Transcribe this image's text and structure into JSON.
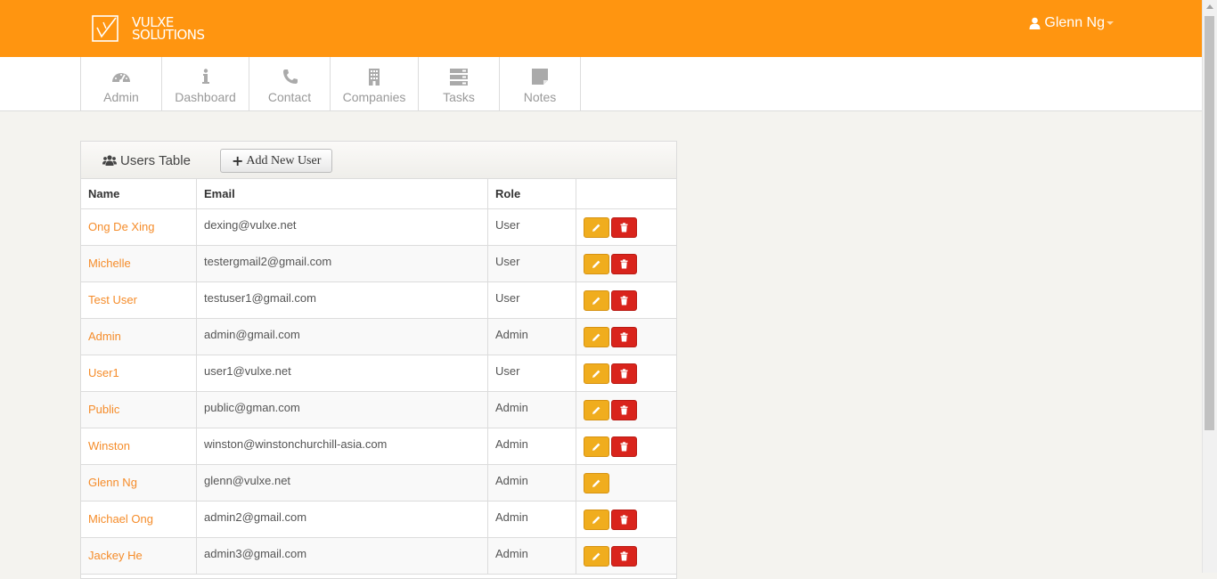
{
  "brand": {
    "line1": "VULXE",
    "line2": "SOLUTIONS"
  },
  "user": {
    "name": "Glenn Ng"
  },
  "nav": [
    {
      "label": "Admin",
      "icon": "dashboard-gauge-icon"
    },
    {
      "label": "Dashboard",
      "icon": "info-icon"
    },
    {
      "label": "Contact",
      "icon": "phone-icon"
    },
    {
      "label": "Companies",
      "icon": "building-icon"
    },
    {
      "label": "Tasks",
      "icon": "tasks-icon"
    },
    {
      "label": "Notes",
      "icon": "note-icon"
    }
  ],
  "panel": {
    "title": "Users Table",
    "add_button": "Add New User"
  },
  "table": {
    "columns": [
      "Name",
      "Email",
      "Role",
      ""
    ],
    "rows": [
      {
        "name": "Ong De Xing",
        "email": "dexing@vulxe.net",
        "role": "User",
        "deletable": true
      },
      {
        "name": "Michelle",
        "email": "testergmail2@gmail.com",
        "role": "User",
        "deletable": true
      },
      {
        "name": "Test User",
        "email": "testuser1@gmail.com",
        "role": "User",
        "deletable": true
      },
      {
        "name": "Admin",
        "email": "admin@gmail.com",
        "role": "Admin",
        "deletable": true
      },
      {
        "name": "User1",
        "email": "user1@vulxe.net",
        "role": "User",
        "deletable": true
      },
      {
        "name": "Public",
        "email": "public@gman.com",
        "role": "Admin",
        "deletable": true
      },
      {
        "name": "Winston",
        "email": "winston@winstonchurchill-asia.com",
        "role": "Admin",
        "deletable": true
      },
      {
        "name": "Glenn Ng",
        "email": "glenn@vulxe.net",
        "role": "Admin",
        "deletable": false
      },
      {
        "name": "Michael Ong",
        "email": "admin2@gmail.com",
        "role": "Admin",
        "deletable": true
      },
      {
        "name": "Jackey He",
        "email": "admin3@gmail.com",
        "role": "Admin",
        "deletable": true
      }
    ]
  },
  "colors": {
    "header_orange": "#ff9510",
    "link_orange": "#f58c2a",
    "edit_yellow": "#f0ad1e",
    "delete_red": "#d9241c"
  }
}
